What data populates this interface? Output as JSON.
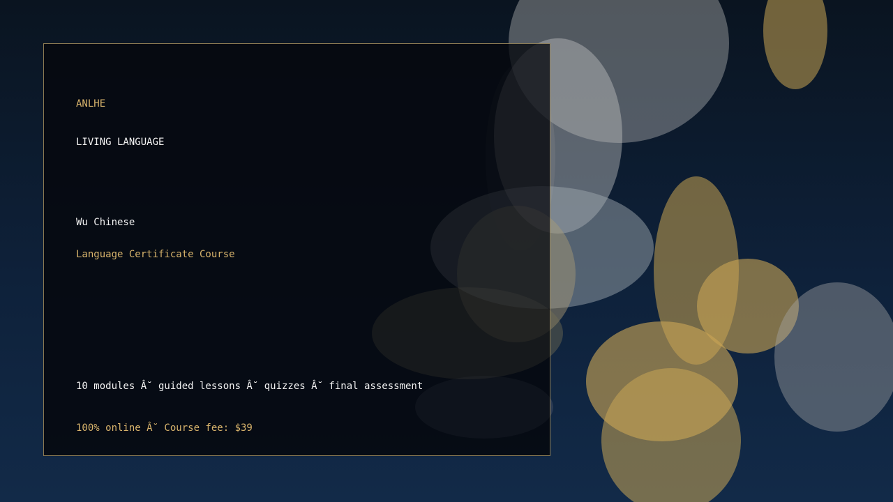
{
  "card": {
    "brand": "ANLHE",
    "tagline": "LIVING LANGUAGE",
    "language": "Wu Chinese",
    "course_type": "Language Certificate Course",
    "details": "10 modules Â˘ guided lessons Â˘ quizzes Â˘ final assessment",
    "pricing": "100% online Â˘ Course fee: $39"
  },
  "colors": {
    "background_top": "#0a1420",
    "background_bottom": "#122a48",
    "accent_gold": "#d8b46c",
    "text_white": "#f2f2f2",
    "card_border": "#8a7a52"
  }
}
